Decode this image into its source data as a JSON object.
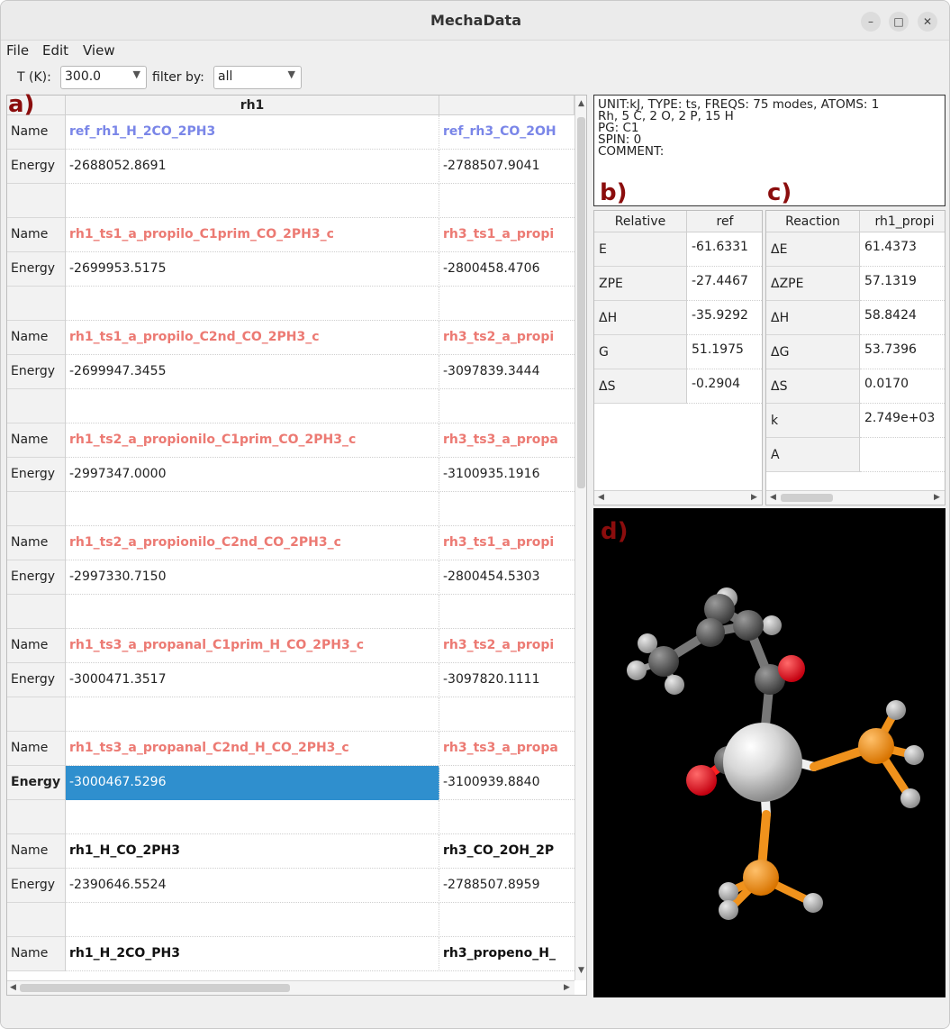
{
  "window": {
    "title": "MechaData"
  },
  "menu": {
    "file": "File",
    "edit": "Edit",
    "view": "View"
  },
  "toolbar": {
    "t_label": "T (K):",
    "t_value": "300.0",
    "filter_label": "filter by:",
    "filter_value": "all"
  },
  "panel_labels": {
    "a": "a)",
    "b": "b)",
    "c": "c)",
    "d": "d)"
  },
  "main_table": {
    "headers": [
      "rh1",
      ""
    ],
    "rows": [
      {
        "label": "Name",
        "v1": "ref_rh1_H_2CO_2PH3",
        "v2": "ref_rh3_CO_2OH",
        "style": "blue"
      },
      {
        "label": "Energy",
        "v1": "-2688052.8691",
        "v2": "-2788507.9041",
        "style": "plain"
      },
      {
        "label": "",
        "v1": "",
        "v2": "",
        "style": "plain"
      },
      {
        "label": "Name",
        "v1": "rh1_ts1_a_propilo_C1prim_CO_2PH3_c",
        "v2": "rh3_ts1_a_propi",
        "style": "red"
      },
      {
        "label": "Energy",
        "v1": "-2699953.5175",
        "v2": "-2800458.4706",
        "style": "plain"
      },
      {
        "label": "",
        "v1": "",
        "v2": "",
        "style": "plain"
      },
      {
        "label": "Name",
        "v1": "rh1_ts1_a_propilo_C2nd_CO_2PH3_c",
        "v2": "rh3_ts2_a_propi",
        "style": "red"
      },
      {
        "label": "Energy",
        "v1": "-2699947.3455",
        "v2": "-3097839.3444",
        "style": "plain"
      },
      {
        "label": "",
        "v1": "",
        "v2": "",
        "style": "plain"
      },
      {
        "label": "Name",
        "v1": "rh1_ts2_a_propionilo_C1prim_CO_2PH3_c",
        "v2": "rh3_ts3_a_propa",
        "style": "red"
      },
      {
        "label": "Energy",
        "v1": "-2997347.0000",
        "v2": "-3100935.1916",
        "style": "plain"
      },
      {
        "label": "",
        "v1": "",
        "v2": "",
        "style": "plain"
      },
      {
        "label": "Name",
        "v1": "rh1_ts2_a_propionilo_C2nd_CO_2PH3_c",
        "v2": "rh3_ts1_a_propi",
        "style": "red"
      },
      {
        "label": "Energy",
        "v1": "-2997330.7150",
        "v2": "-2800454.5303",
        "style": "plain"
      },
      {
        "label": "",
        "v1": "",
        "v2": "",
        "style": "plain"
      },
      {
        "label": "Name",
        "v1": "rh1_ts3_a_propanal_C1prim_H_CO_2PH3_c",
        "v2": "rh3_ts2_a_propi",
        "style": "red"
      },
      {
        "label": "Energy",
        "v1": "-3000471.3517",
        "v2": "-3097820.1111",
        "style": "plain"
      },
      {
        "label": "",
        "v1": "",
        "v2": "",
        "style": "plain"
      },
      {
        "label": "Name",
        "v1": "rh1_ts3_a_propanal_C2nd_H_CO_2PH3_c",
        "v2": "rh3_ts3_a_propa",
        "style": "red"
      },
      {
        "label": "Energy",
        "v1": "-3000467.5296",
        "v2": "-3100939.8840",
        "style": "selected"
      },
      {
        "label": "",
        "v1": "",
        "v2": "",
        "style": "plain"
      },
      {
        "label": "Name",
        "v1": "rh1_H_CO_2PH3",
        "v2": "rh3_CO_2OH_2P",
        "style": "black"
      },
      {
        "label": "Energy",
        "v1": "-2390646.5524",
        "v2": "-2788507.8959",
        "style": "plain"
      },
      {
        "label": "",
        "v1": "",
        "v2": "",
        "style": "plain"
      },
      {
        "label": "Name",
        "v1": "rh1_H_2CO_PH3",
        "v2": "rh3_propeno_H_",
        "style": "black"
      }
    ]
  },
  "info": {
    "line1": "UNIT:kJ,  TYPE: ts,  FREQS: 75 modes, ATOMS: 1",
    "line2": "Rh, 5 C, 2 O, 2 P, 15 H",
    "line3": "PG: C1",
    "line4": "SPIN: 0",
    "line5": "COMMENT:"
  },
  "relative_table": {
    "headers": [
      "Relative",
      "ref"
    ],
    "rows": [
      {
        "label": "E",
        "value": "-61.6331"
      },
      {
        "label": "ZPE",
        "value": "-27.4467"
      },
      {
        "label": "ΔH",
        "value": "-35.9292"
      },
      {
        "label": "G",
        "value": "51.1975"
      },
      {
        "label": "ΔS",
        "value": "-0.2904"
      }
    ]
  },
  "reaction_table": {
    "headers": [
      "Reaction",
      "rh1_propi"
    ],
    "rows": [
      {
        "label": "ΔE",
        "value": "61.4373"
      },
      {
        "label": "ΔZPE",
        "value": "57.1319"
      },
      {
        "label": "ΔH",
        "value": "58.8424"
      },
      {
        "label": "ΔG",
        "value": "53.7396"
      },
      {
        "label": "ΔS",
        "value": "0.0170"
      },
      {
        "label": "k",
        "value": "2.749e+03"
      },
      {
        "label": "A",
        "value": ""
      }
    ]
  },
  "colors": {
    "selection": "#2f8fce",
    "ts_name": "#ec7a73",
    "ref_name": "#7a86e8",
    "panel_label": "#8b0d0d",
    "carbon": "#5a5a5a",
    "rhodium": "#d8d8d8",
    "oxygen": "#e0001a",
    "phosphorus": "#f0921c",
    "hydrogen": "#bbbbbb"
  }
}
